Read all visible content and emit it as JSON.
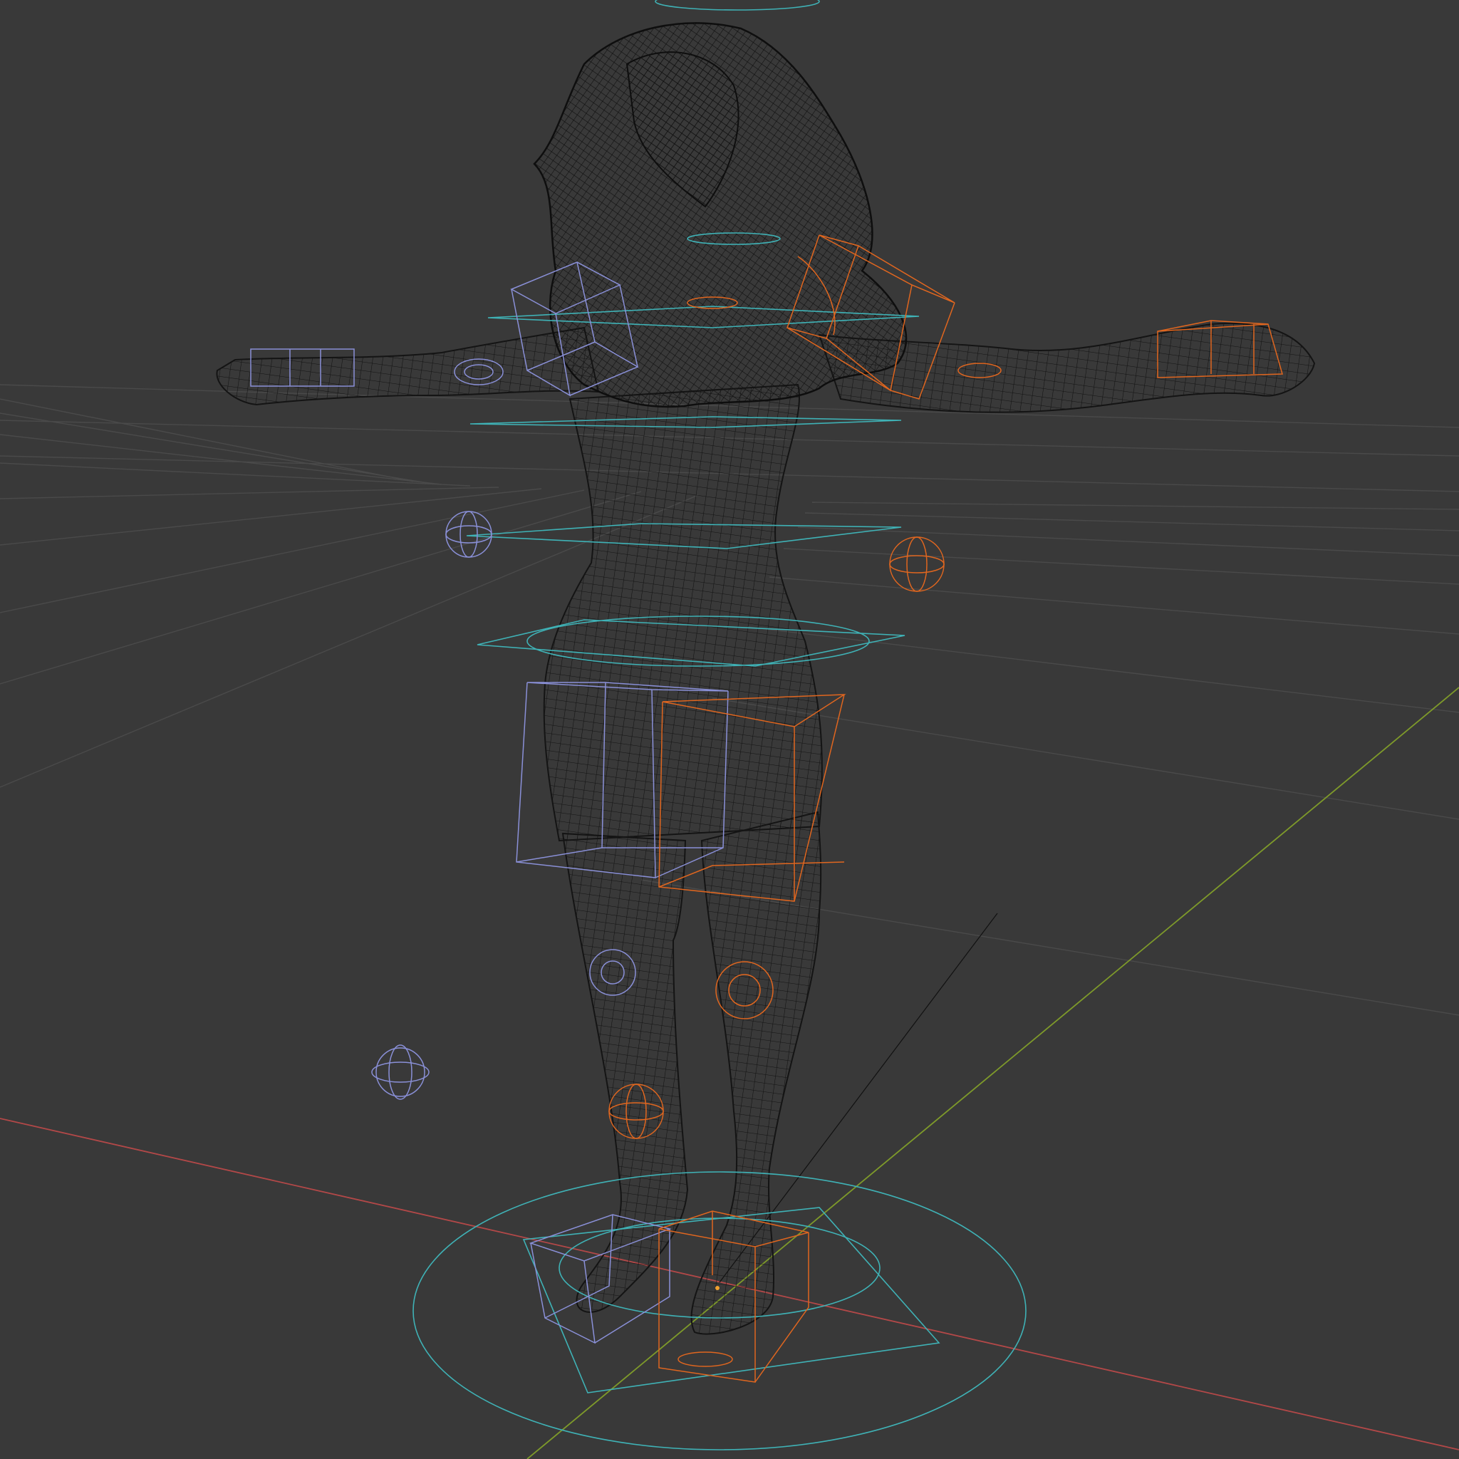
{
  "app": "3D viewport",
  "view": {
    "shading": "wireframe",
    "background_color": "#393939",
    "grid_color": "#4a4a4a",
    "x_axis_color": "#b34848",
    "y_axis_color": "#7e9a2a",
    "mesh_wire_color": "#151515"
  },
  "rig": {
    "left_side_color": "#8a90d8",
    "right_side_color": "#e0661f",
    "center_color": "#3fb2b6",
    "controls": [
      {
        "name": "head-control",
        "side": "center",
        "shape": "circle"
      },
      {
        "name": "neck-control",
        "side": "center",
        "shape": "circle"
      },
      {
        "name": "shoulder-control",
        "side": "center",
        "shape": "circle"
      },
      {
        "name": "chest-control",
        "side": "center",
        "shape": "circle"
      },
      {
        "name": "spine-control",
        "side": "center",
        "shape": "circle"
      },
      {
        "name": "hips-control",
        "side": "center",
        "shape": "circle"
      },
      {
        "name": "root-control",
        "side": "center",
        "shape": "circle"
      },
      {
        "name": "upper-arm-ik",
        "side": "left",
        "shape": "box"
      },
      {
        "name": "upper-arm-ik",
        "side": "right",
        "shape": "box"
      },
      {
        "name": "hand-ik",
        "side": "left",
        "shape": "box"
      },
      {
        "name": "hand-ik",
        "side": "right",
        "shape": "box"
      },
      {
        "name": "elbow-pole",
        "side": "left",
        "shape": "sphere"
      },
      {
        "name": "elbow-pole",
        "side": "right",
        "shape": "sphere"
      },
      {
        "name": "thigh-box",
        "side": "left",
        "shape": "box"
      },
      {
        "name": "thigh-box",
        "side": "right",
        "shape": "box"
      },
      {
        "name": "knee-pole",
        "side": "left",
        "shape": "sphere"
      },
      {
        "name": "knee-pole",
        "side": "right",
        "shape": "sphere"
      },
      {
        "name": "foot-ik",
        "side": "left",
        "shape": "box"
      },
      {
        "name": "foot-ik",
        "side": "right",
        "shape": "box"
      }
    ]
  }
}
